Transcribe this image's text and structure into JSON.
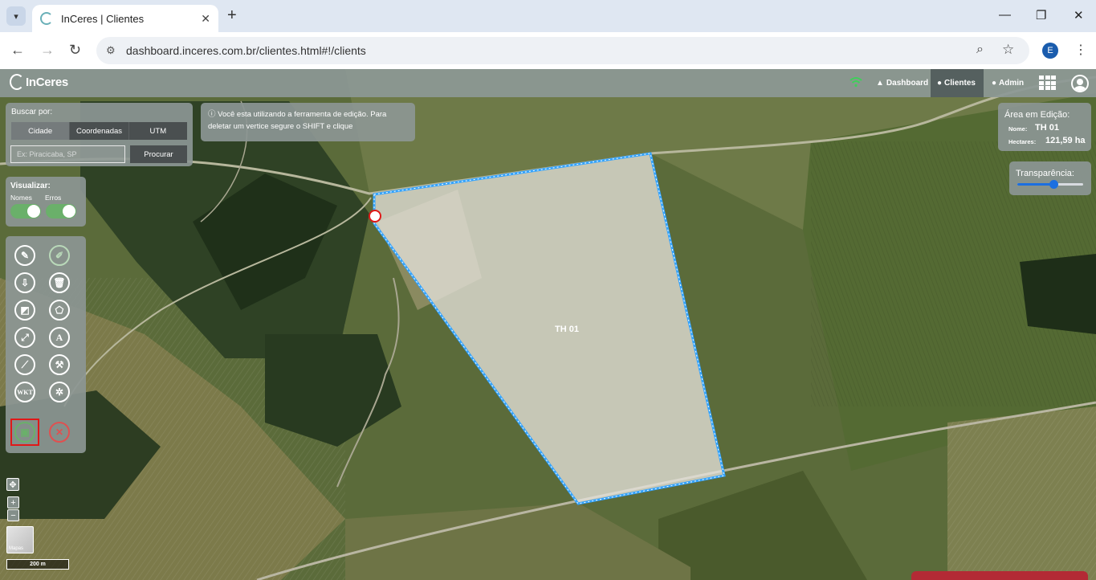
{
  "browser": {
    "tab_title": "InCeres | Clientes",
    "url": "dashboard.inceres.com.br/clientes.html#!/clients",
    "profile_initial": "E"
  },
  "app": {
    "logo": "InCeres",
    "nav": [
      {
        "label": "Dashboard",
        "active": false
      },
      {
        "label": "Clientes",
        "active": true
      },
      {
        "label": "Admin",
        "active": false
      }
    ]
  },
  "search": {
    "label": "Buscar por:",
    "tabs": [
      "Cidade",
      "Coordenadas",
      "UTM"
    ],
    "active_tab": "Cidade",
    "placeholder": "Ex: Piracicaba, SP",
    "button": "Procurar"
  },
  "info": {
    "message": "Você esta utilizando a ferramenta de edição. Para deletar um vertice segure o SHIFT e clique"
  },
  "visualizar": {
    "title": "Visualizar:",
    "toggles": [
      {
        "label": "Nomes",
        "on": true
      },
      {
        "label": "Erros",
        "on": true
      }
    ]
  },
  "tools": {
    "text_tool": "A",
    "wkt_tool": "WKT"
  },
  "area": {
    "title": "Área em Edição:",
    "name_key": "Nome:",
    "name_value": "TH 01",
    "hectares_key": "Hectares:",
    "hectares_value": "121,59 ha"
  },
  "transparency": {
    "label": "Transparência:",
    "value": 0.55
  },
  "map": {
    "polygon_label": "TH 01",
    "zoom_in": "+",
    "zoom_out": "−",
    "basemap_label": "Mapas",
    "scale": "200 m"
  },
  "colors": {
    "polygon_stroke": "#33a3ff",
    "toggle_on": "#6ab06a",
    "save": "#6ab06a",
    "cancel": "#e05050",
    "slider": "#1c6fe0",
    "highlight": "#e01818"
  }
}
